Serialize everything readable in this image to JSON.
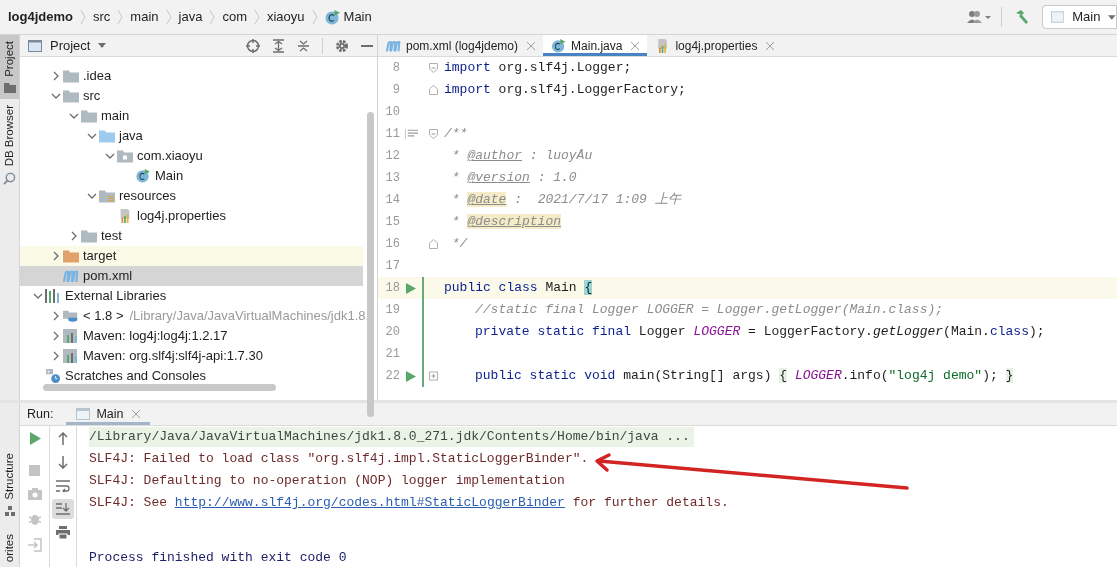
{
  "breadcrumbs": [
    {
      "kind": "project",
      "label": "log4jdemo"
    },
    {
      "kind": "folder",
      "label": "src"
    },
    {
      "kind": "folder",
      "label": "main"
    },
    {
      "kind": "folder",
      "label": "java"
    },
    {
      "kind": "folder",
      "label": "com"
    },
    {
      "kind": "folder",
      "label": "xiaoyu"
    },
    {
      "kind": "class",
      "label": "Main"
    }
  ],
  "toolbar": {
    "run_config": "Main"
  },
  "side_tabs": [
    {
      "label": "Project",
      "selected": true
    },
    {
      "label": "DB Browser",
      "selected": false
    }
  ],
  "bottom_side_tabs": [
    {
      "label": "Structure"
    },
    {
      "label": "orites"
    }
  ],
  "project_panel": {
    "title": "Project",
    "tree": [
      {
        "children": [
          {
            "label": ".idea",
            "kind": "folder",
            "expanded": false,
            "selected": false
          },
          {
            "label": "src",
            "kind": "folder",
            "expanded": true,
            "selected": false,
            "children": [
              {
                "label": "main",
                "kind": "folder",
                "expanded": true,
                "selected": false,
                "children": [
                  {
                    "label": "java",
                    "kind": "source-folder",
                    "expanded": true,
                    "selected": false,
                    "children": [
                      {
                        "label": "com.xiaoyu",
                        "kind": "package",
                        "expanded": true,
                        "selected": false,
                        "children": [
                          {
                            "label": "Main",
                            "kind": "class",
                            "selected": false
                          }
                        ]
                      }
                    ]
                  },
                  {
                    "label": "resources",
                    "kind": "resources-folder",
                    "expanded": true,
                    "selected": false,
                    "children": [
                      {
                        "label": "log4j.properties",
                        "kind": "properties",
                        "selected": false
                      }
                    ]
                  }
                ]
              },
              {
                "label": "test",
                "kind": "folder",
                "expanded": false,
                "selected": false
              }
            ]
          },
          {
            "label": "target",
            "kind": "excluded-folder",
            "expanded": false,
            "selected": false,
            "highlighted": true
          },
          {
            "label": "pom.xml",
            "kind": "maven",
            "selected": true
          }
        ]
      },
      {
        "label": "External Libraries",
        "kind": "libraries",
        "expanded": true,
        "selected": false,
        "children": [
          {
            "label": "< 1.8 >",
            "hint": "/Library/Java/JavaVirtualMachines/jdk1.8.",
            "kind": "jdk",
            "expanded": false,
            "selected": false
          },
          {
            "label": "Maven: log4j:log4j:1.2.17",
            "kind": "library",
            "expanded": false,
            "selected": false
          },
          {
            "label": "Maven: org.slf4j:slf4j-api:1.7.30",
            "kind": "library",
            "expanded": false,
            "selected": false
          }
        ]
      },
      {
        "label": "Scratches and Consoles",
        "kind": "scratches",
        "selected": false
      }
    ]
  },
  "editor": {
    "tabs": [
      {
        "label": "pom.xml (log4jdemo)",
        "kind": "maven",
        "selected": false
      },
      {
        "label": "Main.java",
        "kind": "class",
        "selected": true
      },
      {
        "label": "log4j.properties",
        "kind": "properties",
        "selected": false
      }
    ],
    "lines": [
      {
        "number": "8",
        "current": false,
        "changed": false,
        "fold": {
          "kind": "start"
        },
        "tokens": [
          {
            "kind": "keyword",
            "text": "import"
          },
          {
            "kind": "plain",
            "text": " org.slf4j.Logger;"
          }
        ]
      },
      {
        "number": "9",
        "current": false,
        "changed": false,
        "fold": {
          "kind": "end"
        },
        "tokens": [
          {
            "kind": "keyword",
            "text": "import"
          },
          {
            "kind": "plain",
            "text": " org.slf4j.LoggerFactory;"
          }
        ]
      },
      {
        "number": "10",
        "current": false,
        "changed": false
      },
      {
        "number": "11",
        "current": false,
        "changed": false,
        "gutter": {
          "kind": "doc"
        },
        "fold": {
          "kind": "start"
        },
        "tokens": [
          {
            "kind": "comment",
            "text": "/**"
          }
        ]
      },
      {
        "number": "12",
        "current": false,
        "changed": false,
        "tokens": [
          {
            "kind": "comment",
            "text": " * "
          },
          {
            "kind": "doctag",
            "text": "@author"
          },
          {
            "kind": "comment",
            "text": " : luoyÅu"
          }
        ]
      },
      {
        "number": "13",
        "current": false,
        "changed": false,
        "tokens": [
          {
            "kind": "comment",
            "text": " * "
          },
          {
            "kind": "doctag",
            "text": "@version"
          },
          {
            "kind": "comment",
            "text": " : 1.0"
          }
        ]
      },
      {
        "number": "14",
        "current": false,
        "changed": false,
        "tokens": [
          {
            "kind": "comment",
            "text": " * "
          },
          {
            "kind": "doctag-marked",
            "text": "@date"
          },
          {
            "kind": "comment",
            "text": " :  2021/7/17 1:09 上午"
          }
        ]
      },
      {
        "number": "15",
        "current": false,
        "changed": false,
        "tokens": [
          {
            "kind": "comment",
            "text": " * "
          },
          {
            "kind": "doctag-marked",
            "text": "@description"
          }
        ]
      },
      {
        "number": "16",
        "current": false,
        "changed": false,
        "fold": {
          "kind": "end"
        },
        "tokens": [
          {
            "kind": "comment",
            "text": " */"
          }
        ]
      },
      {
        "number": "17",
        "current": false,
        "changed": false
      },
      {
        "number": "18",
        "current": true,
        "changed": true,
        "indented": false,
        "gutter": {
          "kind": "run"
        },
        "tokens": [
          {
            "kind": "keyword",
            "text": "public class"
          },
          {
            "kind": "plain",
            "text": " Main "
          },
          {
            "kind": "brace-match",
            "text": "{"
          }
        ]
      },
      {
        "number": "19",
        "current": false,
        "changed": true,
        "indented": true,
        "tokens": [
          {
            "kind": "comment",
            "text": "//static final Logger LOGGER = Logger.getLogger(Main.class);"
          }
        ]
      },
      {
        "number": "20",
        "current": false,
        "changed": true,
        "indented": true,
        "tokens": [
          {
            "kind": "keyword",
            "text": "private static final"
          },
          {
            "kind": "plain",
            "text": " Logger "
          },
          {
            "kind": "field",
            "text": "LOGGER"
          },
          {
            "kind": "plain",
            "text": " = LoggerFactory."
          },
          {
            "kind": "method",
            "text": "getLogger"
          },
          {
            "kind": "plain",
            "text": "(Main."
          },
          {
            "kind": "keyword",
            "text": "class"
          },
          {
            "kind": "plain",
            "text": ");"
          }
        ]
      },
      {
        "number": "21",
        "current": false,
        "changed": true
      },
      {
        "number": "22",
        "current": false,
        "changed": true,
        "indented": true,
        "gutter": {
          "kind": "run"
        },
        "fold": {
          "kind": "collapsed"
        },
        "tokens": [
          {
            "kind": "keyword",
            "text": "public static void"
          },
          {
            "kind": "plain",
            "text": " main(String[] args) "
          },
          {
            "kind": "brace",
            "text": "{"
          },
          {
            "kind": "field",
            "text": " LOGGER"
          },
          {
            "kind": "plain",
            "text": ".info("
          },
          {
            "kind": "string",
            "text": "\"log4j demo\""
          },
          {
            "kind": "plain",
            "text": "); "
          },
          {
            "kind": "brace",
            "text": "}"
          }
        ]
      }
    ]
  },
  "run_panel": {
    "label": "Run:",
    "tabs": [
      {
        "label": "Main",
        "selected": true
      }
    ],
    "console": [
      {
        "kind": "command",
        "segments": [
          {
            "kind": "text",
            "text": "/Library/Java/JavaVirtualMachines/jdk1.8.0_271.jdk/Contents/Home/bin/java ..."
          }
        ]
      },
      {
        "kind": "error",
        "segments": [
          {
            "kind": "text",
            "text": "SLF4J: Failed to load class \"org.slf4j.impl.StaticLoggerBinder\"."
          }
        ]
      },
      {
        "kind": "error",
        "segments": [
          {
            "kind": "text",
            "text": "SLF4J: Defaulting to no-operation (NOP) logger implementation"
          }
        ]
      },
      {
        "kind": "error",
        "segments": [
          {
            "kind": "text",
            "text": "SLF4J: See "
          },
          {
            "kind": "link",
            "text": "http://www.slf4j.org/codes.html#StaticLoggerBinder"
          },
          {
            "kind": "text",
            "text": " for further details."
          }
        ]
      },
      {
        "kind": "exit",
        "segments": [
          {
            "kind": "text",
            "text": "Process finished with exit code 0"
          }
        ]
      }
    ]
  }
}
